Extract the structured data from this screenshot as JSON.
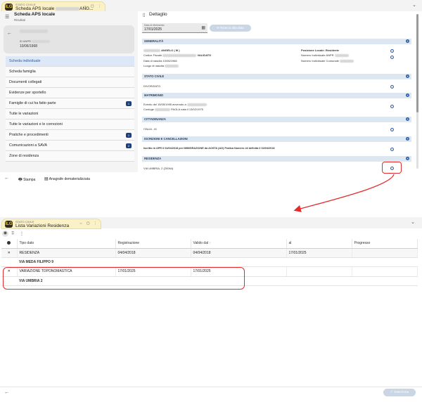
{
  "top": {
    "tab": {
      "kicker": "STATO CIVILE",
      "title": "Scheda APS locale",
      "title_suffix": "ANG...",
      "logo": "ILG"
    },
    "left": {
      "header_title": "Scheda APS locale",
      "header_sub": "Risultati",
      "profile": {
        "id_label": "ID ANPR",
        "birth_date": "10/06/1968"
      },
      "menu": [
        {
          "label": "Scheda individuale",
          "active": true
        },
        {
          "label": "Scheda famiglia"
        },
        {
          "label": "Documenti collegati"
        },
        {
          "label": "Evidenze per sportello"
        },
        {
          "label": "Famiglie di cui ha fatto parte",
          "badge": "1"
        },
        {
          "label": "Tutte le variazioni"
        },
        {
          "label": "Tutte le variazioni e le correzioni"
        },
        {
          "label": "Pratiche e procedimenti",
          "badge": "1"
        },
        {
          "label": "Comunicazioni a SAVA",
          "badge": "2"
        },
        {
          "label": "Zone di residenza"
        }
      ]
    },
    "right": {
      "title": "Dettaglio",
      "date_label": "Data di riferimento",
      "date_value": "17/01/2025",
      "ricerca_label": "Ricerca alla data",
      "sections": {
        "generalita": {
          "title": "GENERALITÀ",
          "name": "ANGELO ( M )",
          "cf_label": "Codice Fiscale",
          "cf_status": "VALIDATO",
          "birth": "Data di nascita 10/06/1968",
          "birthplace": "Luogo di nascita",
          "pos_label": "Posizione Locale: Residente",
          "anpr_label": "Numero Individuale ANPR",
          "comunale_label": "Numero Individuale Comunale"
        },
        "stato_civile": {
          "title": "STATO CIVILE",
          "value": "DIVORZIATO"
        },
        "matrimonio": {
          "title": "MATRIMONIO",
          "line1": "Evento del 15/05/1995 avvenuto a",
          "line2": "Coniuge",
          "line2_b": "PAOLA nata il 13/02/1975"
        },
        "cittadinanza": {
          "title": "CITTADINANZA",
          "value": "ITALIA - I8"
        },
        "iscrizioni": {
          "title": "ISCRIZIONI E CANCELLAZIONI",
          "value": "Iscritto in APR il 04/04/2018 per IMMIGRAZIONE da AOSTA (AO) Pratica Numero 44 definita il 04/04/2018"
        },
        "residenza": {
          "title": "RESIDENZA",
          "value": "VIA UMBRIA, 2 (20064)"
        }
      }
    },
    "footer": {
      "stampa": "Stampa",
      "anagrafe": "Anagrafe dematerializzata"
    }
  },
  "bottom": {
    "tab": {
      "kicker": "STATO CIVILE",
      "title": "Lista Variazioni Residenza",
      "logo": "ILG"
    },
    "columns": [
      "Tipo dato",
      "Registrazione",
      "Valido dal",
      "al",
      "Progresso"
    ],
    "sort_indicator": "↑",
    "rows": [
      {
        "tipo": "RESIDENZA",
        "registrazione": "04/04/2018",
        "valido_dal": "04/04/2018",
        "al": "17/01/2025",
        "progresso": ""
      },
      {
        "sub": "VIA MEDA FILIPPO 9"
      },
      {
        "tipo": "VARIAZIONE TOPONOMASTICA",
        "registrazione": "17/01/2025",
        "valido_dal": "17/01/2025",
        "al": "",
        "progresso": ""
      },
      {
        "sub": "VIA UMBRIA 2"
      }
    ],
    "seleziona_label": "Seleziona"
  },
  "colors": {
    "accent": "#2a5ea8",
    "highlight": "#e52b2b",
    "tab_bg": "#fbf1c6"
  }
}
